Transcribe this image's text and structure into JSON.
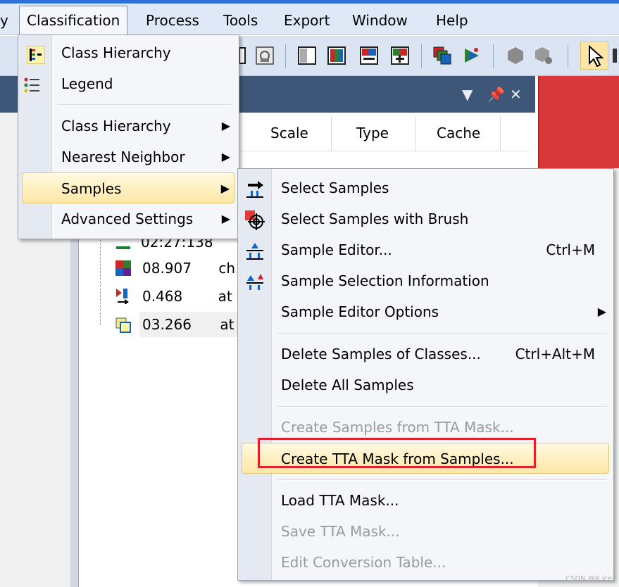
{
  "menubar": {
    "items": [
      {
        "label": "y"
      },
      {
        "label": "Classification"
      },
      {
        "label": "Process"
      },
      {
        "label": "Tools"
      },
      {
        "label": "Export"
      },
      {
        "label": "Window"
      },
      {
        "label": "Help"
      }
    ]
  },
  "grid": {
    "headers": [
      "Scale",
      "Type",
      "Cache"
    ]
  },
  "tree": {
    "rows": [
      {
        "value": "02:27:138",
        "extra": ""
      },
      {
        "value": "08.907",
        "extra": "ch"
      },
      {
        "value": "0.468",
        "extra": "at"
      },
      {
        "value": "03.266",
        "extra": "at"
      }
    ]
  },
  "classification_menu": {
    "items": [
      {
        "label": "Class Hierarchy",
        "icon": "class-hierarchy-icon",
        "submenu": false
      },
      {
        "label": "Legend",
        "icon": "legend-icon",
        "submenu": false
      },
      {
        "label": "Class Hierarchy",
        "submenu": true
      },
      {
        "label": "Nearest Neighbor",
        "submenu": true
      },
      {
        "label": "Samples",
        "submenu": true,
        "highlighted": true
      },
      {
        "label": "Advanced Settings",
        "submenu": true
      }
    ]
  },
  "samples_menu": {
    "items": [
      {
        "label": "Select Samples",
        "icon": "select-samples-icon",
        "shortcut": ""
      },
      {
        "label": "Select Samples with Brush",
        "icon": "brush-icon",
        "shortcut": ""
      },
      {
        "label": "Sample Editor...",
        "icon": "sample-editor-icon",
        "shortcut": "Ctrl+M"
      },
      {
        "label": "Sample Selection Information",
        "icon": "selection-info-icon",
        "shortcut": ""
      },
      {
        "label": "Sample Editor Options",
        "shortcut": "",
        "submenu": true
      },
      {
        "label": "Delete Samples of Classes...",
        "shortcut": "Ctrl+Alt+M"
      },
      {
        "label": "Delete All Samples",
        "shortcut": ""
      },
      {
        "label": "Create Samples from TTA Mask...",
        "shortcut": "",
        "disabled": true
      },
      {
        "label": "Create TTA Mask from Samples...",
        "shortcut": "",
        "highlighted": true
      },
      {
        "label": "Load TTA Mask...",
        "shortcut": ""
      },
      {
        "label": "Save TTA Mask...",
        "shortcut": "",
        "disabled": true
      },
      {
        "label": "Edit Conversion Table...",
        "shortcut": "",
        "disabled": true
      }
    ]
  },
  "watermark": "CSDN @R.ice",
  "colors": {
    "highlight_border": "#e2202c",
    "menubar": "#dfe8f6",
    "panel_title": "#3e5677",
    "accent_red": "#d9383a"
  }
}
